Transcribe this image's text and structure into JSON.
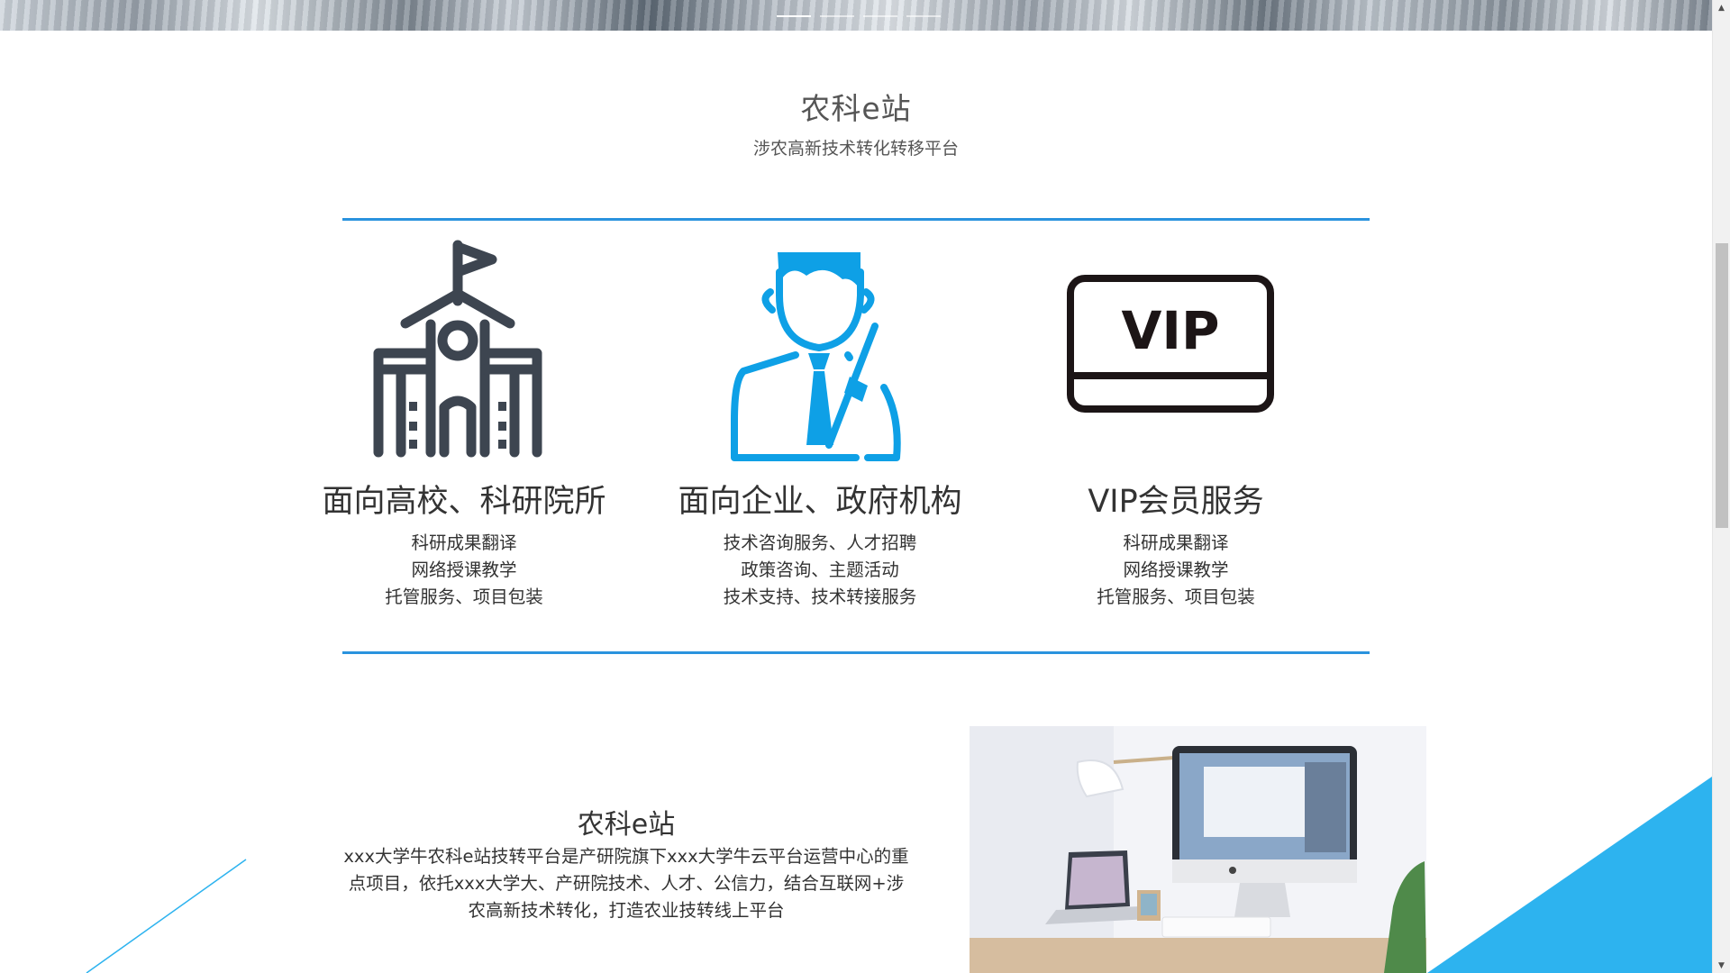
{
  "banner": {
    "dots": 4,
    "active_dot": 0
  },
  "intro": {
    "title": "农科e站",
    "subtitle": "涉农高新技术转化转移平台"
  },
  "features": [
    {
      "icon": "school-building-icon",
      "title": "面向高校、科研院所",
      "lines": [
        "科研成果翻译",
        "网络授课教学",
        "托管服务、项目包装"
      ]
    },
    {
      "icon": "business-person-icon",
      "title": "面向企业、政府机构",
      "lines": [
        "技术咨询服务、人才招聘",
        "政策咨询、主题活动",
        "技术支持、技术转接服务"
      ]
    },
    {
      "icon": "vip-card-icon",
      "title": "VIP会员服务",
      "lines": [
        "科研成果翻译",
        "网络授课教学",
        "托管服务、项目包装"
      ]
    }
  ],
  "about": {
    "title": "农科e站",
    "text": "xxx大学牛农科e站技转平台是产研院旗下xxx大学牛云平台运营中心的重点项目，依托xxx大学大、产研院技术、人才、公信力，结合互联网+涉农高新技术转化，打造农业技转线上平台"
  },
  "vip_icon_text": "VIP",
  "colors": {
    "accent": "#2a93de",
    "icon_dark": "#3d4550",
    "icon_blue": "#0ea0e6",
    "deco_blue": "#2db3ef"
  }
}
